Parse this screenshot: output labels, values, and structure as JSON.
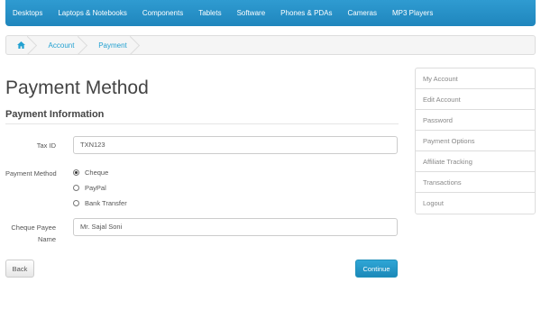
{
  "topnav": {
    "items": [
      "Desktops",
      "Laptops & Notebooks",
      "Components",
      "Tablets",
      "Software",
      "Phones & PDAs",
      "Cameras",
      "MP3 Players"
    ]
  },
  "breadcrumb": {
    "home_icon": "home-icon",
    "account": "Account",
    "payment": "Payment"
  },
  "page": {
    "title": "Payment Method",
    "section": "Payment Information"
  },
  "form": {
    "tax_id_label": "Tax ID",
    "tax_id_value": "TXN123",
    "payment_method_label": "Payment Method",
    "options": [
      "Cheque",
      "PayPal",
      "Bank Transfer"
    ],
    "selected": "Cheque",
    "payee_label_line1": "Cheque Payee",
    "payee_label_line2": "Name",
    "payee_value": "Mr. Sajal Soni"
  },
  "buttons": {
    "back": "Back",
    "continue": "Continue"
  },
  "sidebar": {
    "items": [
      "My Account",
      "Edit Account",
      "Password",
      "Payment Options",
      "Affiliate Tracking",
      "Transactions",
      "Logout"
    ]
  },
  "colors": {
    "accent": "#229ac8",
    "link": "#23a1d1"
  }
}
